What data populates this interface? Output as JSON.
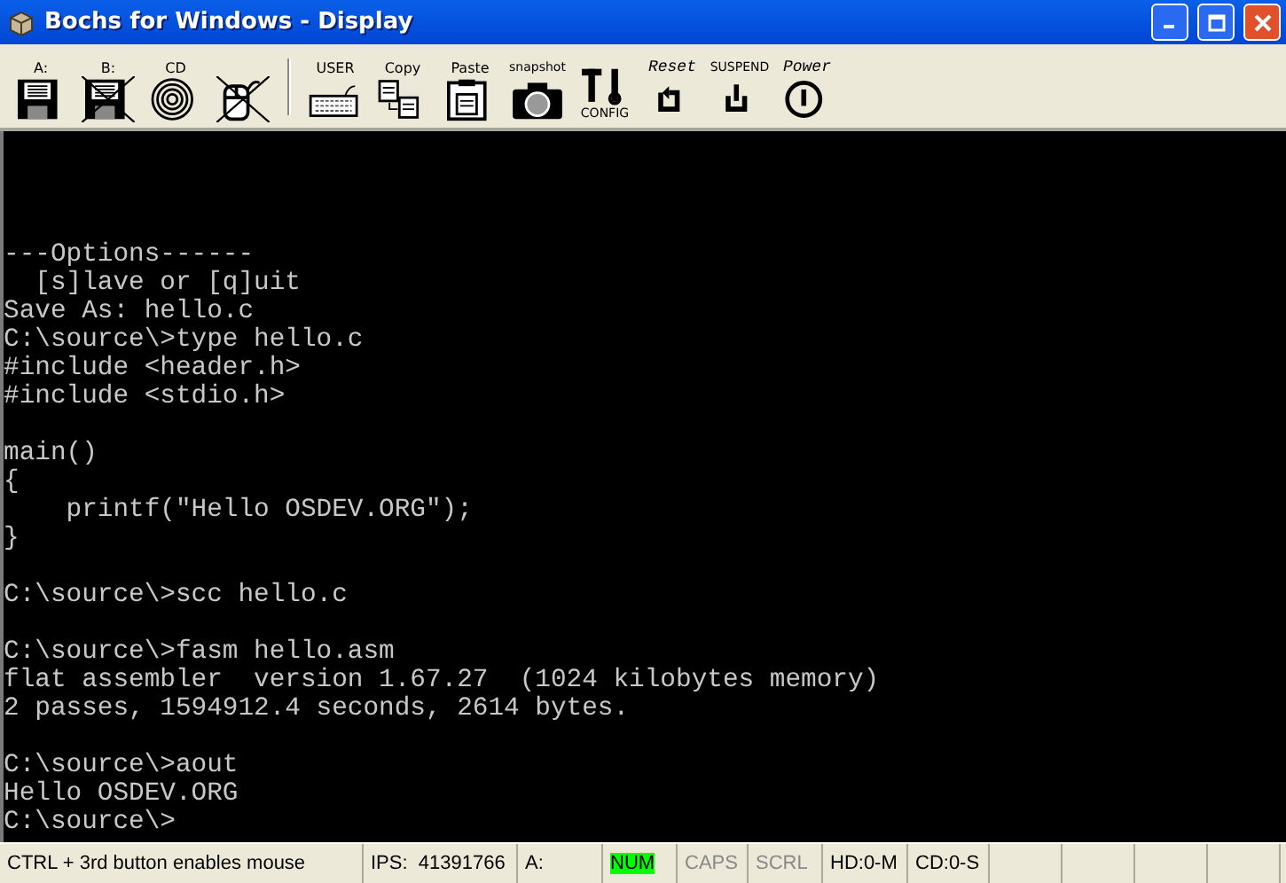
{
  "window": {
    "title": "Bochs for Windows - Display"
  },
  "toolbar": [
    {
      "kind": "floppy",
      "label": "A:",
      "disabled": false
    },
    {
      "kind": "floppy",
      "label": "B:",
      "disabled": true
    },
    {
      "kind": "cdrom",
      "label": "CD",
      "disabled": false
    },
    {
      "kind": "mouse",
      "disabled": true
    },
    {
      "kind": "keyboard",
      "label": "USER",
      "disabled": false
    },
    {
      "kind": "copy",
      "label": "Copy",
      "disabled": false
    },
    {
      "kind": "paste",
      "label": "Paste",
      "disabled": false
    },
    {
      "kind": "camera",
      "label": "snapshot",
      "disabled": false
    },
    {
      "kind": "config",
      "label": "CONFIG",
      "disabled": false
    },
    {
      "kind": "reset",
      "label": "Reset",
      "disabled": false
    },
    {
      "kind": "suspend",
      "label": "SUSPEND",
      "disabled": false
    },
    {
      "kind": "power",
      "label": "Power",
      "disabled": false
    }
  ],
  "screen": {
    "blocks": [
      [
        "---Options------",
        "  [s]lave or [q]uit",
        "Save As: hello.c",
        "C:\\source\\>type hello.c",
        "#include <header.h>",
        "#include <stdio.h>"
      ],
      [
        "main()",
        "{",
        "    printf(\"Hello OSDEV.ORG\");",
        "}"
      ],
      [
        "C:\\source\\>scc hello.c"
      ],
      [
        "C:\\source\\>fasm hello.asm",
        "flat assembler  version 1.67.27  (1024 kilobytes memory)",
        "2 passes, 1594912.4 seconds, 2614 bytes."
      ],
      [
        "C:\\source\\>aout",
        "Hello OSDEV.ORG",
        "C:\\source\\>"
      ]
    ]
  },
  "status_bar": [
    {
      "kind": "text",
      "text": "CTRL + 3rd button enables mouse"
    },
    {
      "kind": "text",
      "text": "IPS:  41391766"
    },
    {
      "kind": "text",
      "text": "A:"
    },
    {
      "kind": "indicator",
      "text": "NUM",
      "on": true
    },
    {
      "kind": "indicator",
      "text": "CAPS",
      "on": false
    },
    {
      "kind": "indicator",
      "text": "SCRL",
      "on": false
    },
    {
      "kind": "text",
      "text": "HD:0-M"
    },
    {
      "kind": "text",
      "text": "CD:0-S"
    }
  ]
}
